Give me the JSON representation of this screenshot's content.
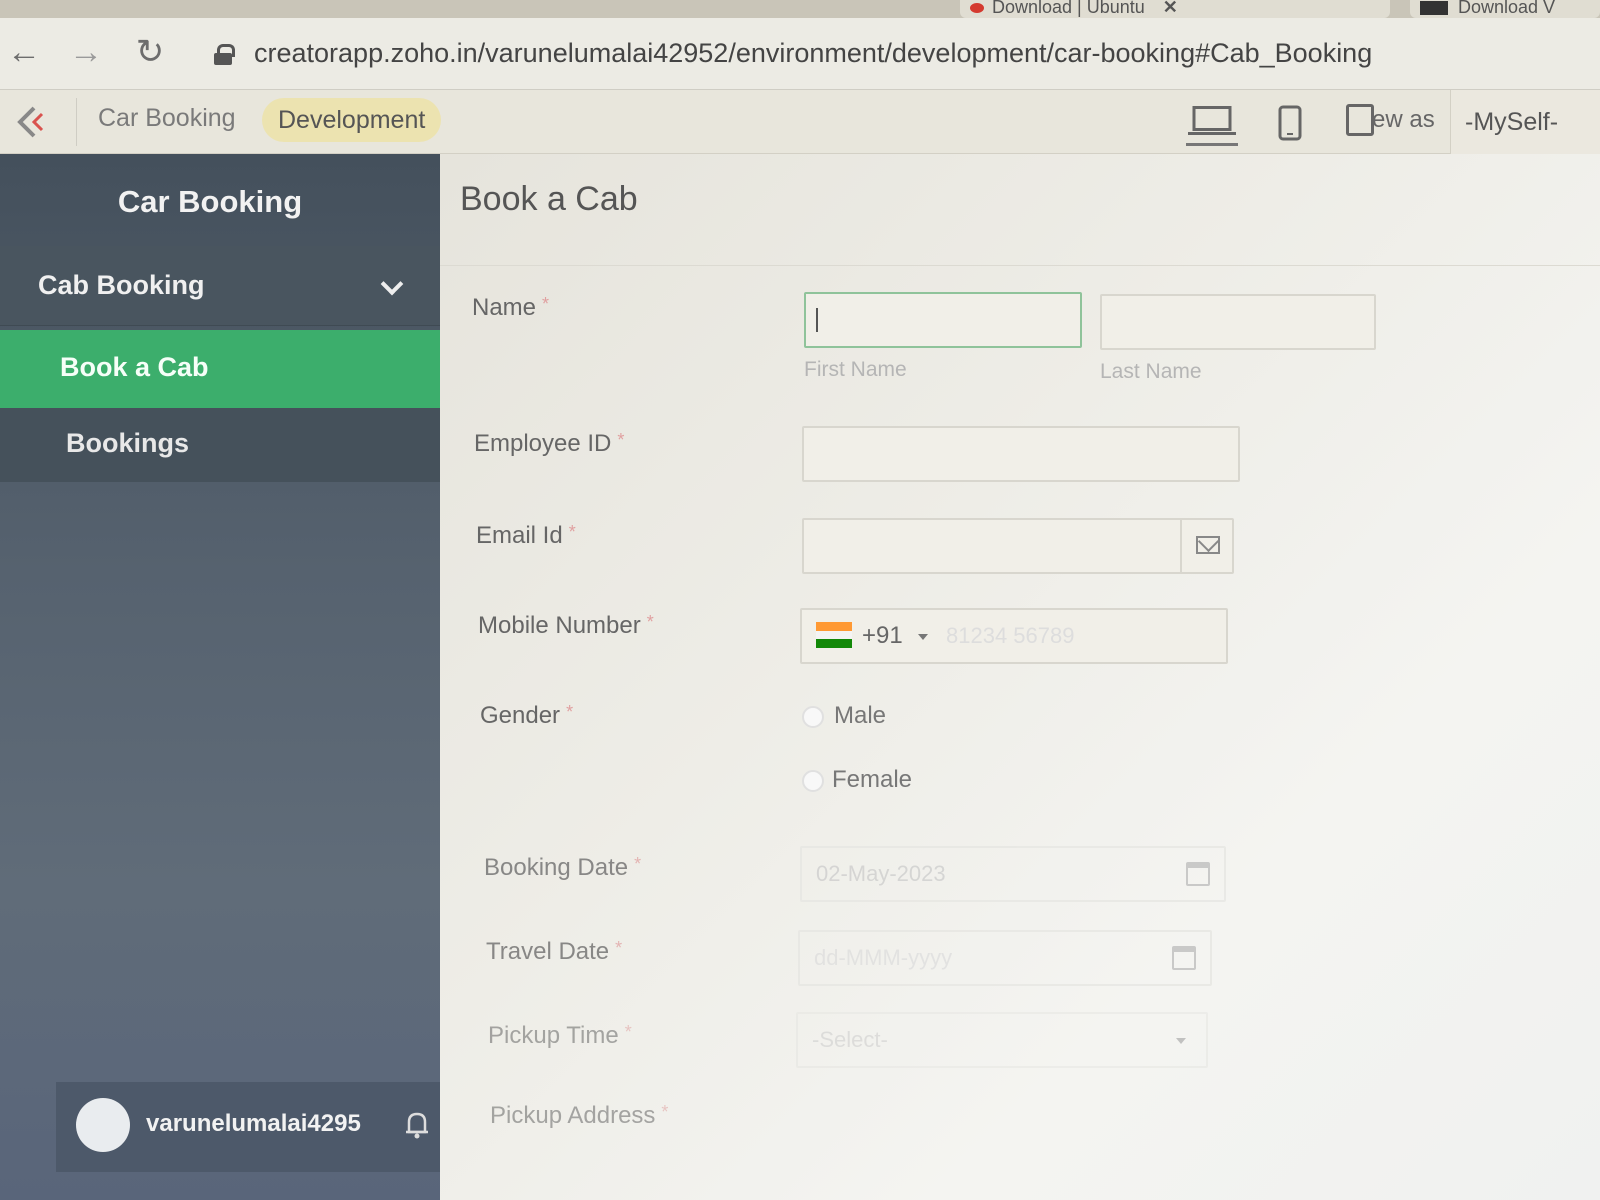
{
  "browser": {
    "tabs": [
      {
        "label": "Download | Ubuntu",
        "close": "✕"
      },
      {
        "label": "Download V"
      }
    ],
    "url": "creatorapp.zoho.in/varunelumalai42952/environment/development/car-booking#Cab_Booking",
    "nav_back": "←",
    "nav_forward": "→",
    "nav_reload": "↻"
  },
  "appbar": {
    "app_name": "Car Booking",
    "environment": "Development",
    "view_as_label": "ew as",
    "view_as_value": "-MySelf-"
  },
  "sidebar": {
    "title": "Car Booking",
    "group": "Cab Booking",
    "items": [
      {
        "label": "Book a Cab",
        "active": true
      },
      {
        "label": "Bookings",
        "active": false
      }
    ],
    "user": "varunelumalai4295"
  },
  "form": {
    "title": "Book a Cab",
    "required_mark": "*",
    "name": {
      "label": "Name",
      "first_sub": "First Name",
      "last_sub": "Last Name",
      "first_value": "",
      "last_value": ""
    },
    "employee_id": {
      "label": "Employee ID",
      "value": ""
    },
    "email": {
      "label": "Email Id",
      "value": ""
    },
    "mobile": {
      "label": "Mobile Number",
      "country_code": "+91",
      "placeholder": "81234 56789"
    },
    "gender": {
      "label": "Gender",
      "options": [
        "Male",
        "Female"
      ]
    },
    "booking_date": {
      "label": "Booking Date",
      "value": "02-May-2023"
    },
    "travel_date": {
      "label": "Travel Date",
      "placeholder": "dd-MMM-yyyy"
    },
    "pickup_time": {
      "label": "Pickup Time",
      "value": "-Select-"
    },
    "pickup_address": {
      "label": "Pickup Address"
    }
  },
  "colors": {
    "sidebar_active": "#3cae6c",
    "env_badge": "#ece3b0",
    "flag_saffron": "#ff9933",
    "flag_green": "#138808"
  }
}
